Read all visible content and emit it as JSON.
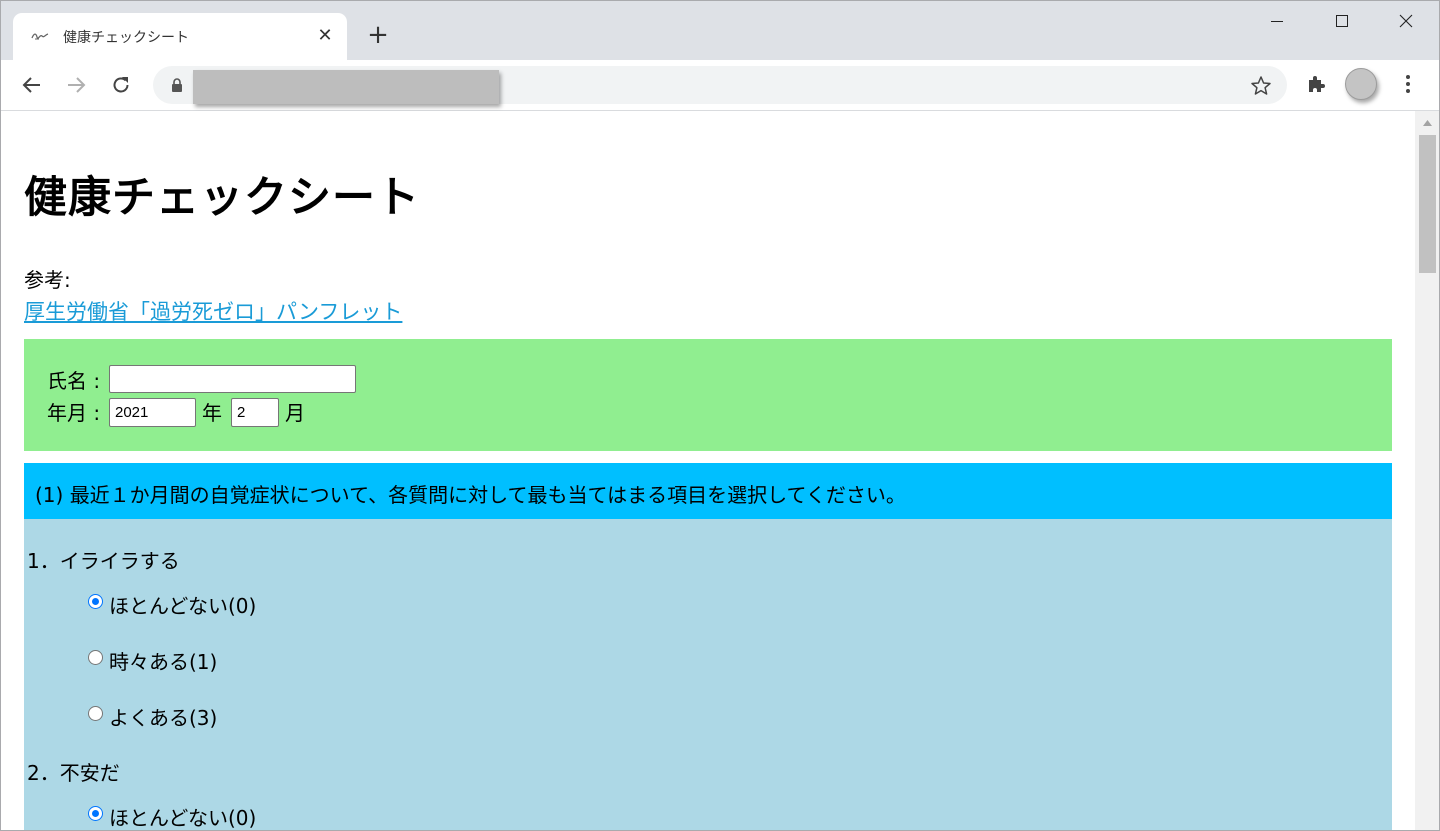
{
  "browser": {
    "tab_title": "健康チェックシート",
    "new_tab_symbol": "+",
    "close_symbol": "✕"
  },
  "page": {
    "title": "健康チェックシート",
    "reference_label": "参考:",
    "reference_link": "厚生労働省「過労死ゼロ」パンフレット"
  },
  "form": {
    "name_label": "氏名 :",
    "name_value": "",
    "date_label": "年月 :",
    "year_value": "2021",
    "year_unit": "年",
    "month_value": "2",
    "month_unit": "月"
  },
  "section1": {
    "header": "(1) 最近１か月間の自覚症状について、各質問に対して最も当てはまる項目を選択してください。",
    "questions": [
      {
        "label": "1．イライラする",
        "options": [
          {
            "label": "ほとんどない(0)",
            "checked": true
          },
          {
            "label": "時々ある(1)",
            "checked": false
          },
          {
            "label": "よくある(3)",
            "checked": false
          }
        ]
      },
      {
        "label": "2．不安だ",
        "options": [
          {
            "label": "ほとんどない(0)",
            "checked": true
          }
        ]
      }
    ]
  },
  "colors": {
    "info_box": "#90ee90",
    "section_header": "#00bfff",
    "question_area": "#add8e6",
    "link": "#1a9bd7",
    "radio_accent": "#0075ff"
  }
}
